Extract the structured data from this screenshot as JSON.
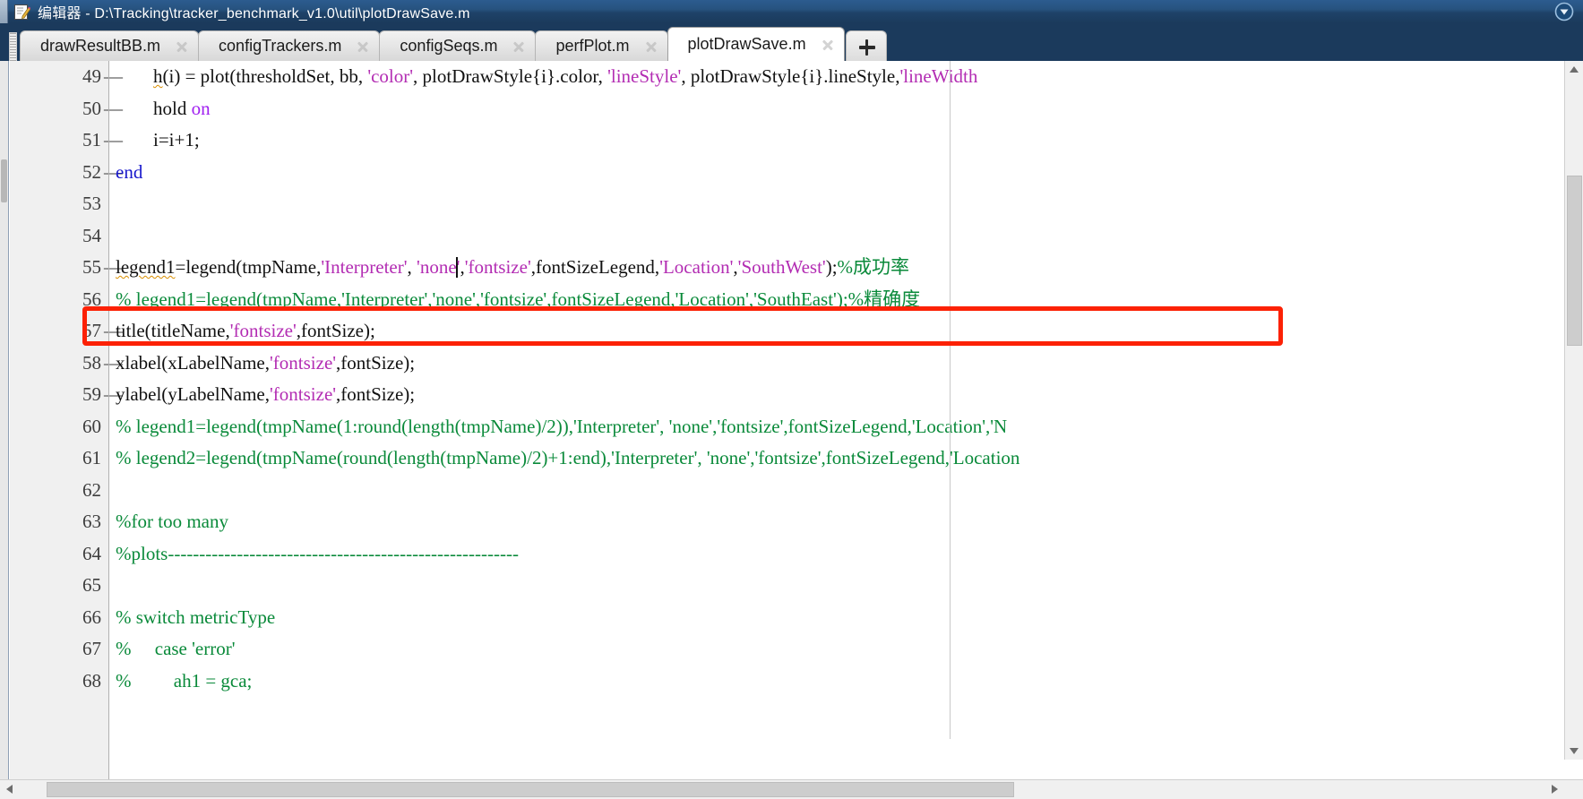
{
  "window": {
    "app_name": "编辑器",
    "title": "编辑器 - D:\\Tracking\\tracker_benchmark_v1.0\\util\\plotDrawSave.m",
    "icon": "editor-document-pencil-icon",
    "dropdown_icon": "circle-chevron-down-icon",
    "titlebar_color": "#1e4268"
  },
  "tabs": {
    "items": [
      {
        "label": "drawResultBB.m",
        "active": false,
        "close_icon": "close-icon"
      },
      {
        "label": "configTrackers.m",
        "active": false,
        "close_icon": "close-icon"
      },
      {
        "label": "configSeqs.m",
        "active": false,
        "close_icon": "close-icon"
      },
      {
        "label": "perfPlot.m",
        "active": false,
        "close_icon": "close-icon"
      },
      {
        "label": "plotDrawSave.m",
        "active": true,
        "close_icon": "close-icon"
      }
    ],
    "new_tab_label": "+",
    "new_tab_icon": "plus-icon"
  },
  "editor": {
    "first_visible_line": 49,
    "highlight_annotation": {
      "line": 55,
      "color": "#fc2105",
      "shape": "rectangle"
    },
    "caret_line": 55,
    "syntax_colors": {
      "string": "#b32db3",
      "comment": "#0a8a3a",
      "keyword": "#1818cc",
      "keyword_alt": "#a020f0",
      "plain": "#111111",
      "squiggle": "#d98e00"
    },
    "lines": [
      {
        "number": "49",
        "marker": "—",
        "tokens": [
          {
            "t": "        ",
            "c": "plain"
          },
          {
            "t": "h",
            "c": "squiggle"
          },
          {
            "t": "(i) = plot(thresholdSet, bb, ",
            "c": "plain"
          },
          {
            "t": "'color'",
            "c": "string"
          },
          {
            "t": ", plotDrawStyle{i}.color, ",
            "c": "plain"
          },
          {
            "t": "'lineStyle'",
            "c": "string"
          },
          {
            "t": ", plotDrawStyle{i}.lineStyle,",
            "c": "plain"
          },
          {
            "t": "'lineWidth",
            "c": "string"
          }
        ]
      },
      {
        "number": "50",
        "marker": "—",
        "tokens": [
          {
            "t": "        hold ",
            "c": "plain"
          },
          {
            "t": "on",
            "c": "keyword_alt"
          }
        ]
      },
      {
        "number": "51",
        "marker": "—",
        "tokens": [
          {
            "t": "        i=i+1;",
            "c": "plain"
          }
        ]
      },
      {
        "number": "52",
        "marker": "—",
        "tokens": [
          {
            "t": "end",
            "c": "keyword"
          }
        ]
      },
      {
        "number": "53",
        "marker": "",
        "tokens": []
      },
      {
        "number": "54",
        "marker": "",
        "tokens": []
      },
      {
        "number": "55",
        "marker": "—",
        "tokens": [
          {
            "t": "legend1",
            "c": "squiggle"
          },
          {
            "t": "=legend(tmpName,",
            "c": "plain"
          },
          {
            "t": "'Interpreter'",
            "c": "string"
          },
          {
            "t": ", ",
            "c": "plain"
          },
          {
            "t": "'none",
            "c": "string"
          },
          {
            "t": "|CARET|",
            "c": "caret"
          },
          {
            "t": "'",
            "c": "string"
          },
          {
            "t": ",",
            "c": "plain"
          },
          {
            "t": "'fontsize'",
            "c": "string"
          },
          {
            "t": ",fontSizeLegend,",
            "c": "plain"
          },
          {
            "t": "'Location'",
            "c": "string"
          },
          {
            "t": ",",
            "c": "plain"
          },
          {
            "t": "'SouthWest'",
            "c": "string"
          },
          {
            "t": ");",
            "c": "plain"
          },
          {
            "t": "%成功率",
            "c": "comment"
          }
        ]
      },
      {
        "number": "56",
        "marker": "",
        "tokens": [
          {
            "t": "% legend1=legend(tmpName,'Interpreter','none','fontsize',fontSizeLegend,'Location','SouthEast');%精确度",
            "c": "comment"
          }
        ]
      },
      {
        "number": "57",
        "marker": "—",
        "tokens": [
          {
            "t": "title(titleName,",
            "c": "plain"
          },
          {
            "t": "'fontsize'",
            "c": "string"
          },
          {
            "t": ",fontSize);",
            "c": "plain"
          }
        ]
      },
      {
        "number": "58",
        "marker": "—",
        "tokens": [
          {
            "t": "xlabel(xLabelName,",
            "c": "plain"
          },
          {
            "t": "'fontsize'",
            "c": "string"
          },
          {
            "t": ",fontSize);",
            "c": "plain"
          }
        ]
      },
      {
        "number": "59",
        "marker": "—",
        "tokens": [
          {
            "t": "ylabel(yLabelName,",
            "c": "plain"
          },
          {
            "t": "'fontsize'",
            "c": "string"
          },
          {
            "t": ",fontSize);",
            "c": "plain"
          }
        ]
      },
      {
        "number": "60",
        "marker": "",
        "tokens": [
          {
            "t": "% legend1=legend(tmpName(1:round(length(tmpName)/2)),'Interpreter', 'none','fontsize',fontSizeLegend,'Location','N",
            "c": "comment"
          }
        ]
      },
      {
        "number": "61",
        "marker": "",
        "tokens": [
          {
            "t": "% legend2=legend(tmpName(round(length(tmpName)/2)+1:end),'Interpreter', 'none','fontsize',fontSizeLegend,'Location",
            "c": "comment"
          }
        ]
      },
      {
        "number": "62",
        "marker": "",
        "tokens": []
      },
      {
        "number": "63",
        "marker": "",
        "tokens": [
          {
            "t": "%for too many",
            "c": "comment"
          }
        ]
      },
      {
        "number": "64",
        "marker": "",
        "tokens": [
          {
            "t": "%plots--------------------------------------------------------",
            "c": "comment"
          }
        ]
      },
      {
        "number": "65",
        "marker": "",
        "tokens": []
      },
      {
        "number": "66",
        "marker": "",
        "tokens": [
          {
            "t": "% switch metricType",
            "c": "comment"
          }
        ]
      },
      {
        "number": "67",
        "marker": "",
        "tokens": [
          {
            "t": "%     case 'error'",
            "c": "comment"
          }
        ]
      },
      {
        "number": "68",
        "marker": "",
        "tokens": [
          {
            "t": "%         ah1 = gca;",
            "c": "comment"
          }
        ]
      }
    ]
  },
  "scrollbars": {
    "vertical": {
      "up_icon": "arrow-up-icon",
      "down_icon": "arrow-down-icon"
    },
    "horizontal": {
      "left_icon": "arrow-left-icon",
      "right_icon": "arrow-right-icon"
    }
  }
}
